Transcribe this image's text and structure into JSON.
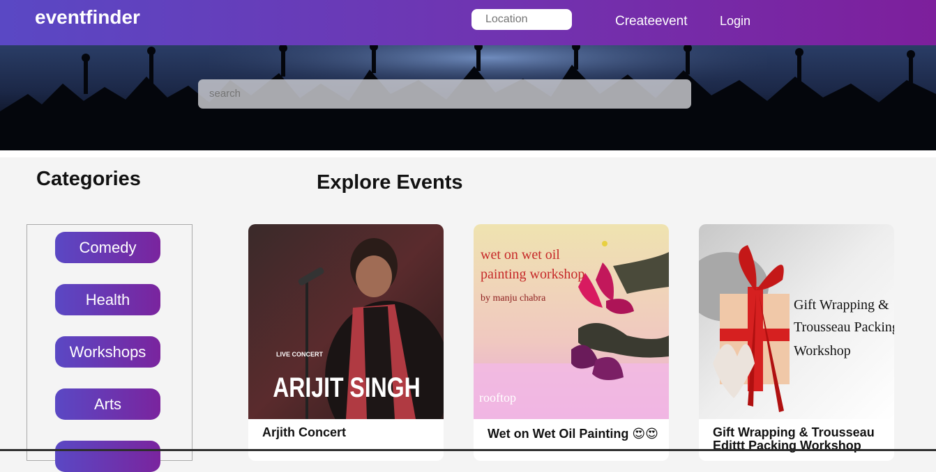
{
  "navbar": {
    "brand": "eventfinder",
    "location_placeholder": "Location",
    "create_label": "Createevent",
    "login_label": "Login"
  },
  "hero": {
    "search_placeholder": "search"
  },
  "categories": {
    "title": "Categories",
    "items": [
      "Comedy",
      "Health",
      "Workshops",
      "Arts",
      ""
    ]
  },
  "explore": {
    "title": "Explore Events",
    "events": [
      {
        "title": "Arjith Concert",
        "poster_subtitle": "LIVE CONCERT",
        "poster_title": "ARIJIT SINGH"
      },
      {
        "title": "Wet on Wet Oil Painting 😍😍",
        "poster_line1": "wet on wet oil",
        "poster_line2": "painting workshop",
        "poster_line3": "by manju chabra",
        "poster_logo": "rooftop"
      },
      {
        "title": "Gift Wrapping & Trousseau Edittt Packing Workshop",
        "poster_line1": "Gift Wrapping &",
        "poster_line2": "Trousseau Packing",
        "poster_line3": "Workshop"
      }
    ]
  },
  "colors": {
    "nav_gradient_start": "#5a48c4",
    "nav_gradient_end": "#7d1f9c",
    "background": "#f4f4f4"
  }
}
